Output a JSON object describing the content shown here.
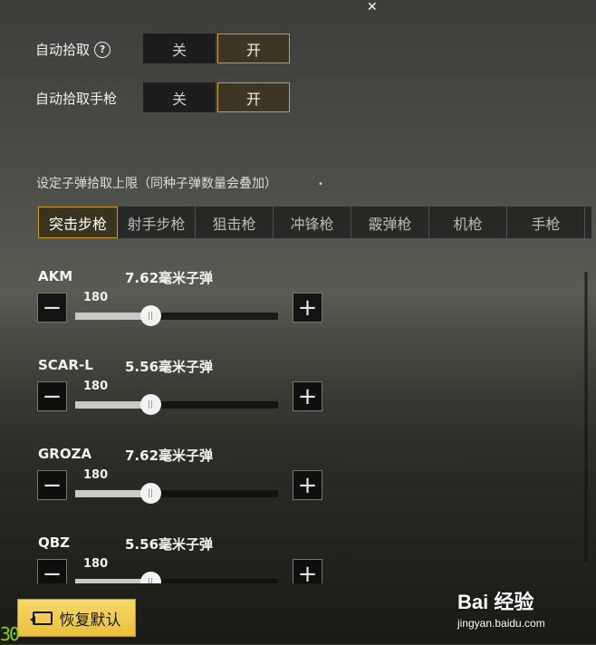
{
  "auto_pickup": {
    "label": "自动拾取",
    "off": "关",
    "on": "开",
    "state": "on"
  },
  "auto_pickup_pistol": {
    "label": "自动拾取手枪",
    "off": "关",
    "on": "开",
    "state": "on"
  },
  "ammo_limit_title": "设定子弹拾取上限（同种子弹数量会叠加）",
  "tabs": [
    "突击步枪",
    "射手步枪",
    "狙击枪",
    "冲锋枪",
    "霰弹枪",
    "机枪",
    "手枪"
  ],
  "active_tab": 0,
  "weapons": [
    {
      "name": "AKM",
      "ammo": "7.62毫米子弹",
      "value": "180",
      "fraction": 0.37
    },
    {
      "name": "SCAR-L",
      "ammo": "5.56毫米子弹",
      "value": "180",
      "fraction": 0.37
    },
    {
      "name": "GROZA",
      "ammo": "7.62毫米子弹",
      "value": "180",
      "fraction": 0.37
    },
    {
      "name": "QBZ",
      "ammo": "5.56毫米子弹",
      "value": "180",
      "fraction": 0.37
    }
  ],
  "reset_label": "恢复默认",
  "fps": "30",
  "watermark": {
    "brand": "Bai  经验",
    "url": "jingyan.baidu.com"
  },
  "colors": {
    "accent": "#c9a227",
    "reset_bg": "#f0cd52",
    "fps": "#7ed321"
  }
}
